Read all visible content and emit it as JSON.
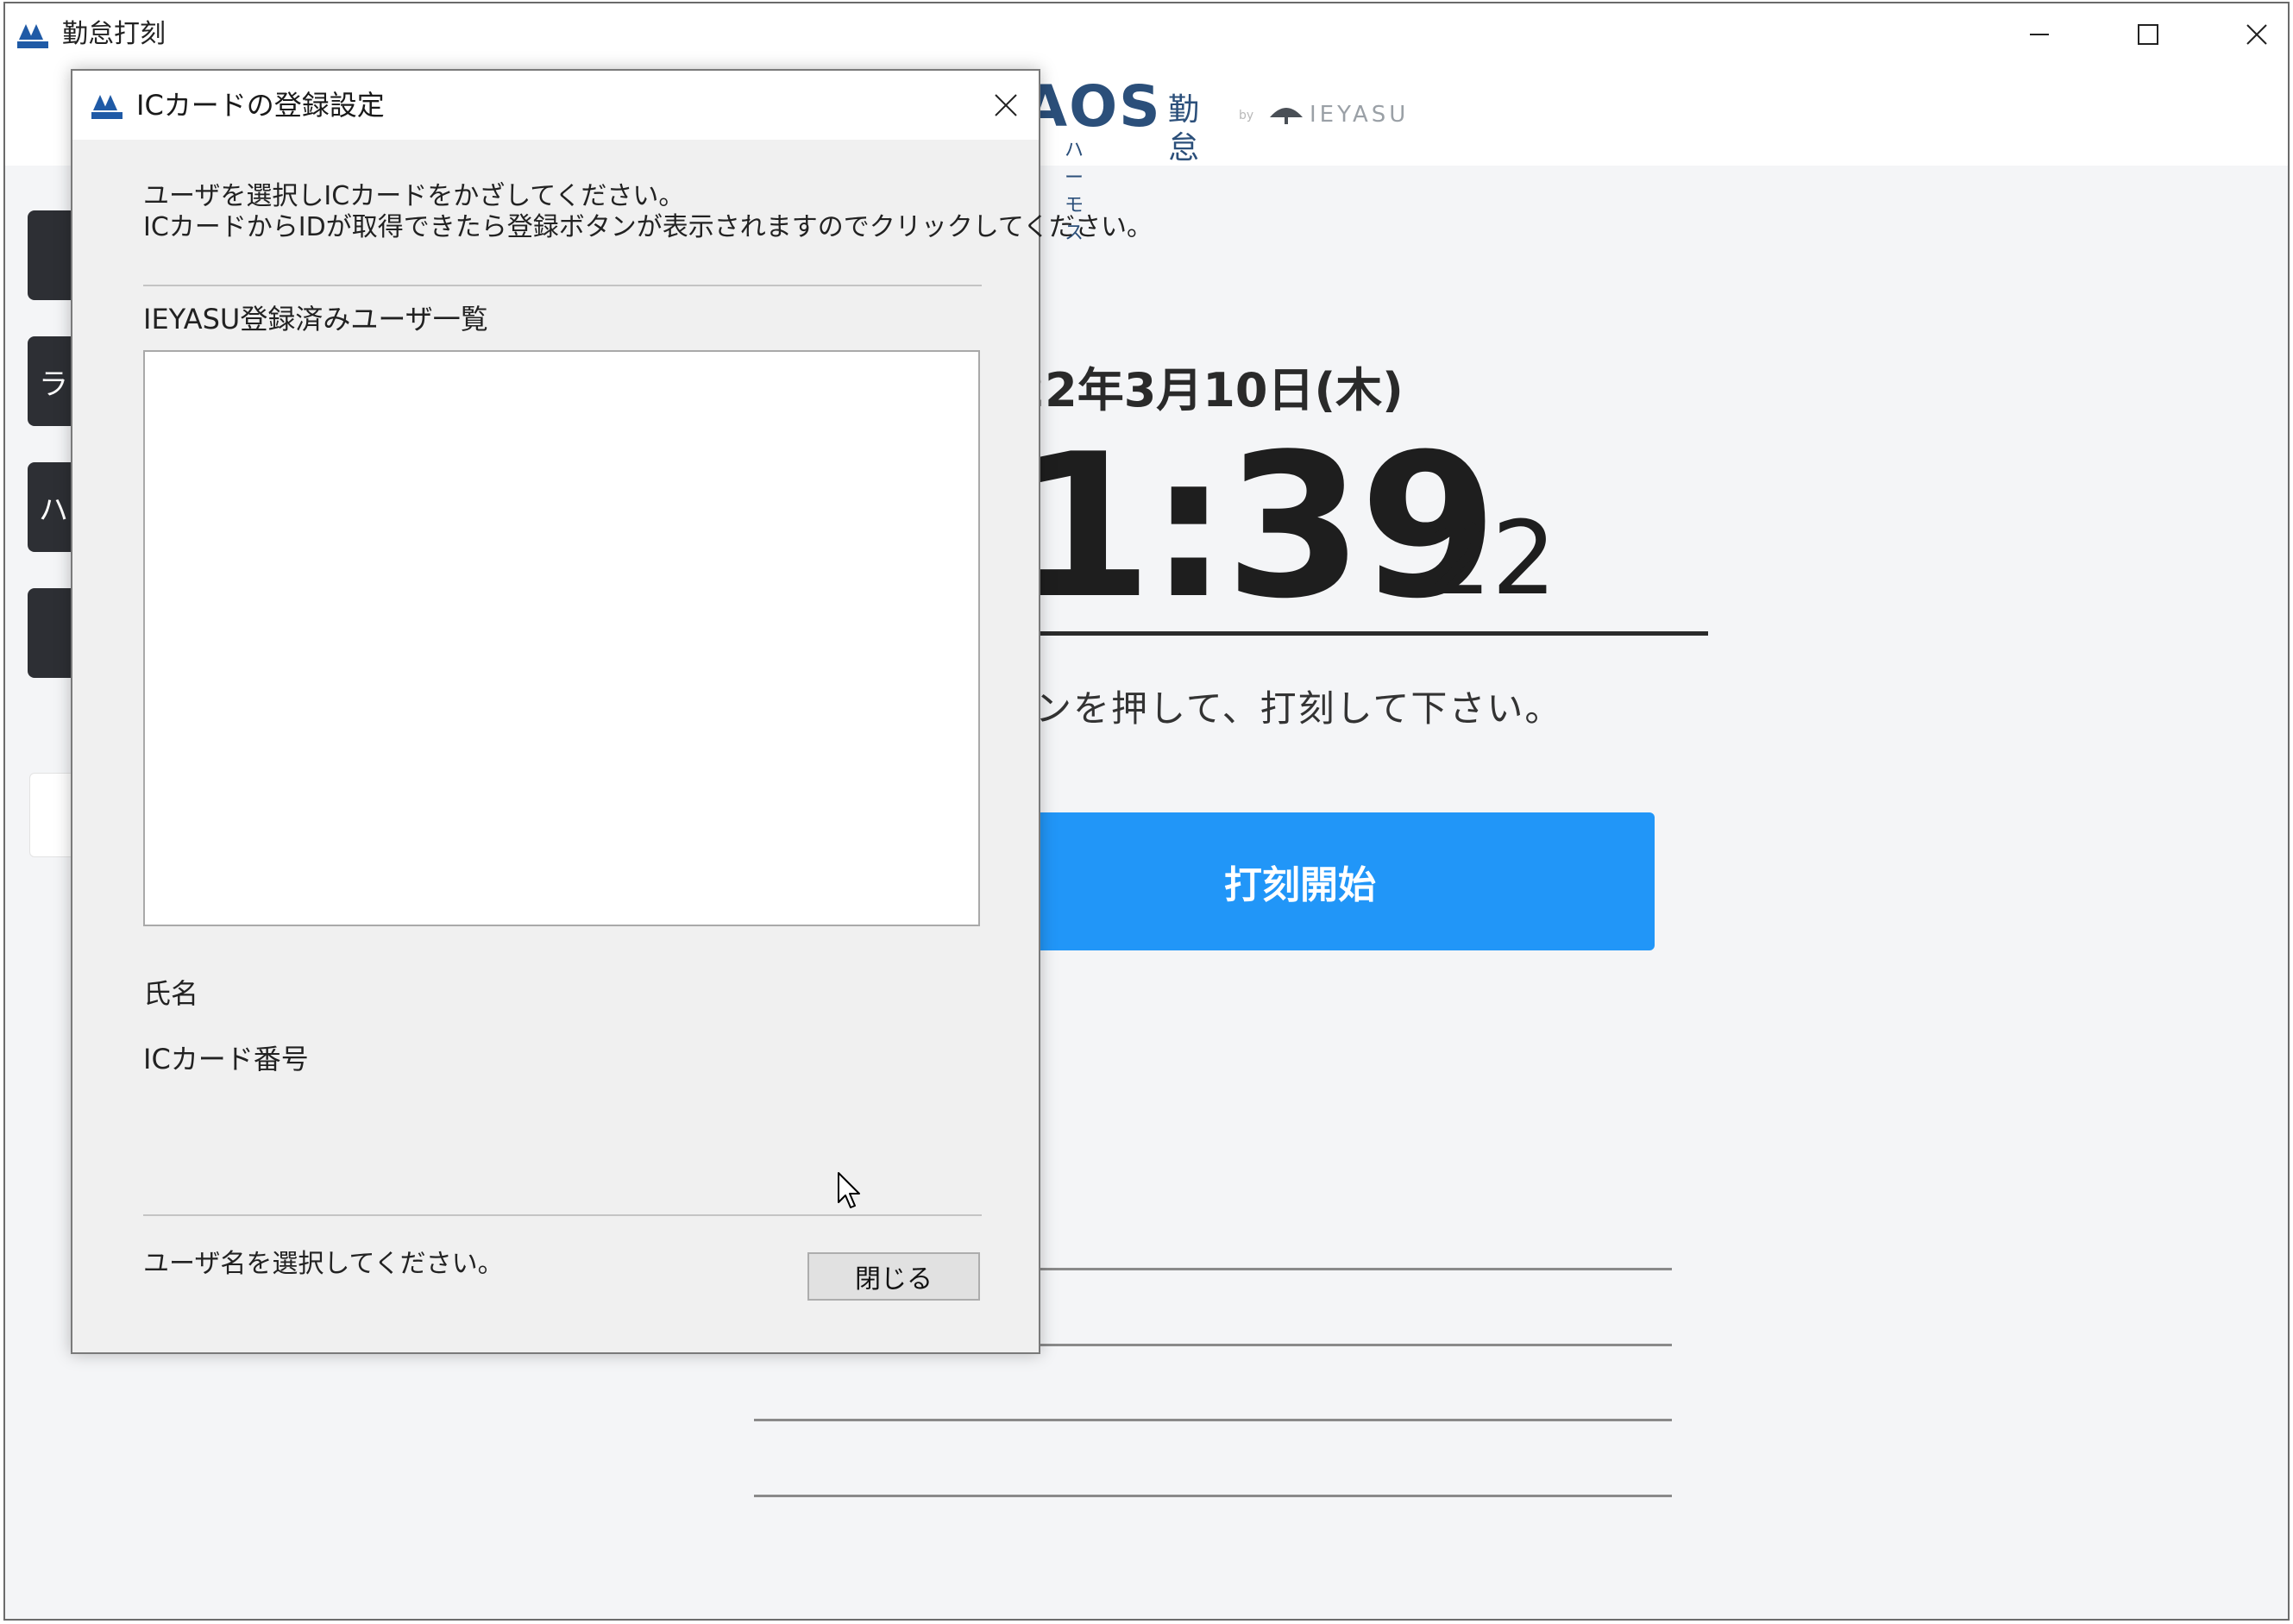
{
  "window": {
    "title": "勤怠打刻"
  },
  "logo": {
    "main": "AOS",
    "kintai": "勤怠",
    "by": "by",
    "ieyasu": "IEYASU",
    "kana": "ハーモス"
  },
  "sidebar": {
    "items": [
      {
        "label": ""
      },
      {
        "label": "ラ"
      },
      {
        "label": "ハ"
      },
      {
        "label": ""
      }
    ]
  },
  "clock": {
    "date": "022年3月10日(木)",
    "time": "1:39",
    "seconds": "22"
  },
  "main": {
    "instruction": "タンを押して、打刻して下さい。",
    "start_button": "打刻開始"
  },
  "dialog": {
    "title": "ICカードの登録設定",
    "instruction_line1": "ユーザを選択しICカードをかざしてください。",
    "instruction_line2": "ICカードからIDが取得できたら登録ボタンが表示されますのでクリックしてください。",
    "list_label": "IEYASU登録済みユーザ一覧",
    "users": [],
    "name_label": "氏名",
    "card_number_label": "ICカード番号",
    "status_message": "ユーザ名を選択してください。",
    "close_button": "閉じる"
  },
  "colors": {
    "accent": "#2196f8",
    "logo": "#2b4f7a",
    "sidebar_button": "#2d2f34"
  }
}
